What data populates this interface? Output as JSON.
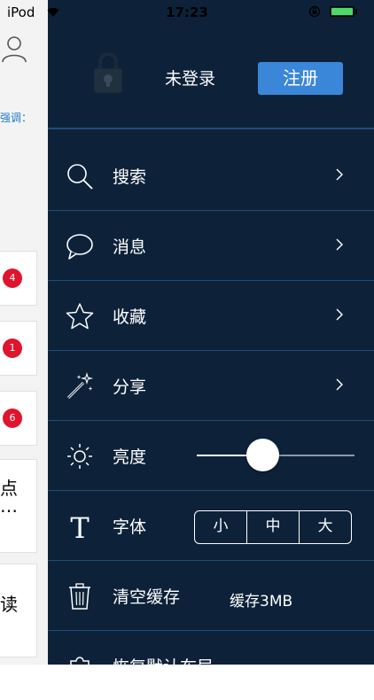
{
  "status_bar": {
    "carrier": "iPod",
    "time": "17:23"
  },
  "background": {
    "emphasis_text": "强调：",
    "badges": [
      "4",
      "1",
      "6"
    ],
    "snippet_1": "点",
    "snippet_1_more": "…",
    "snippet_2": "读"
  },
  "menu": {
    "login_status": "未登录",
    "register_label": "注册",
    "items": {
      "search": "搜索",
      "messages": "消息",
      "favorites": "收藏",
      "share": "分享",
      "brightness": "亮度",
      "font": "字体",
      "clear_cache": "清空缓存",
      "restore": "恢复默认布局"
    },
    "brightness_level": 0.42,
    "font_sizes": [
      "小",
      "中",
      "大"
    ],
    "cache_size": "缓存3MB"
  },
  "colors": {
    "menu_bg": "#0d2239",
    "accent": "#3a86d8",
    "divider": "#1d4e7c",
    "badge": "#e0142d"
  }
}
